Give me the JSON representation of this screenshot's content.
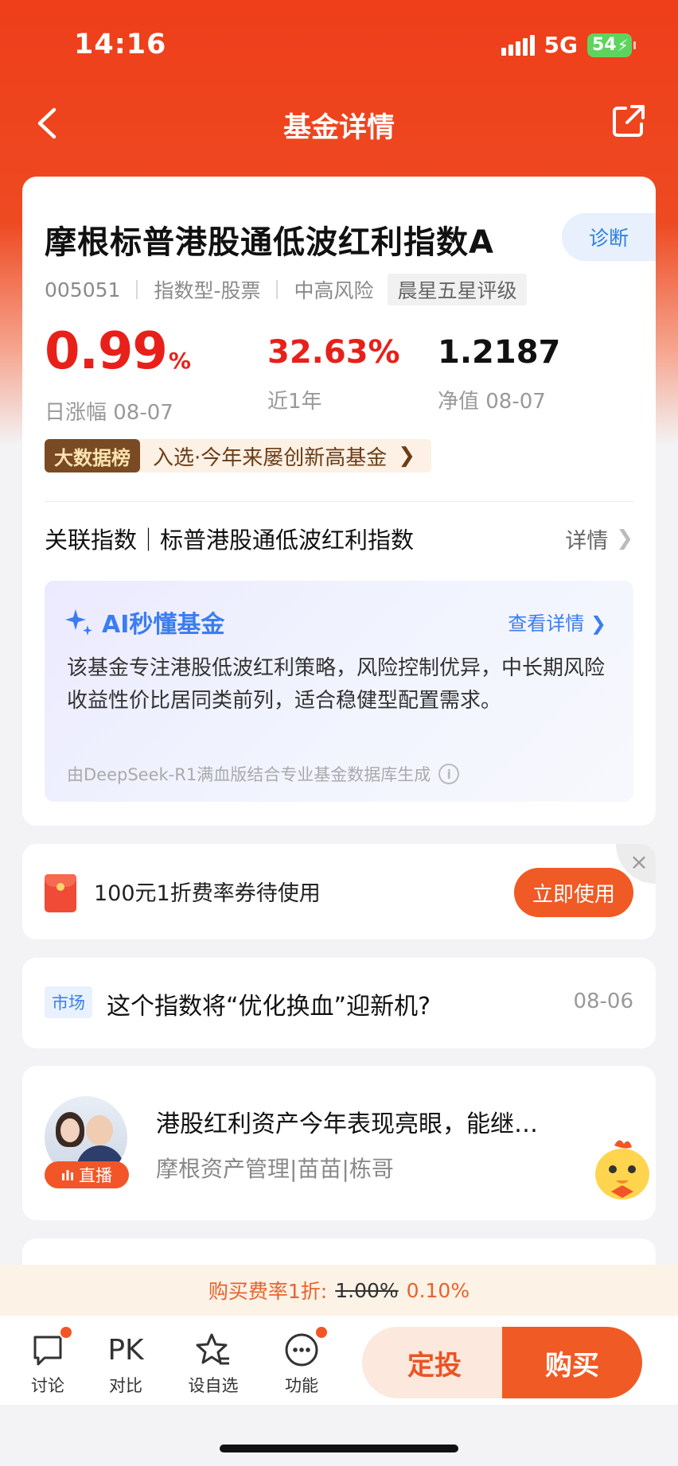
{
  "status_bar": {
    "time": "14:16",
    "network": "5G",
    "battery": "54"
  },
  "nav": {
    "title": "基金详情"
  },
  "fund": {
    "name": "摩根标普港股通低波红利指数A",
    "diagnose_label": "诊断",
    "code": "005051",
    "type": "指数型-股票",
    "risk": "中高风险",
    "rating": "晨星五星评级"
  },
  "stats": {
    "daily_change": {
      "value": "0.99",
      "unit": "%",
      "label": "日涨幅 08-07"
    },
    "one_year": {
      "value": "32.63%",
      "label": "近1年"
    },
    "nav": {
      "value": "1.2187",
      "label": "净值 08-07"
    }
  },
  "ranking": {
    "badge": "大数据榜",
    "text": "入选·今年来屡创新高基金"
  },
  "index_row": {
    "label": "关联指数｜标普港股通低波红利指数",
    "detail": "详情"
  },
  "ai": {
    "title": "AI秒懂基金",
    "more": "查看详情",
    "description": "该基金专注港股低波红利策略，风险控制优异，中长期风险收益性价比居同类前列，适合稳健型配置需求。",
    "footnote": "由DeepSeek-R1满血版结合专业基金数据库生成"
  },
  "coupon": {
    "text": "100元1折费率券待使用",
    "button": "立即使用"
  },
  "news": {
    "tag": "市场",
    "title": "这个指数将“优化换血”迎新机?",
    "date": "08-06"
  },
  "live": {
    "badge": "直播",
    "title": "港股红利资产今年表现亮眼，能继…",
    "subtitle": "摩根资产管理|苗苗|栋哥"
  },
  "fee_banner": {
    "prefix": "购买费率1折:",
    "old_rate": "1.00%",
    "new_rate": "0.10%"
  },
  "toolbar": {
    "discuss": "讨论",
    "pk_icon": "PK",
    "compare": "对比",
    "watchlist": "设自选",
    "functions": "功能",
    "dingtou": "定投",
    "buy": "购买"
  },
  "colors": {
    "brand": "#ee3e1a",
    "up_red": "#e8201a",
    "ai_blue": "#3a7df0",
    "button_orange": "#f05a24"
  }
}
